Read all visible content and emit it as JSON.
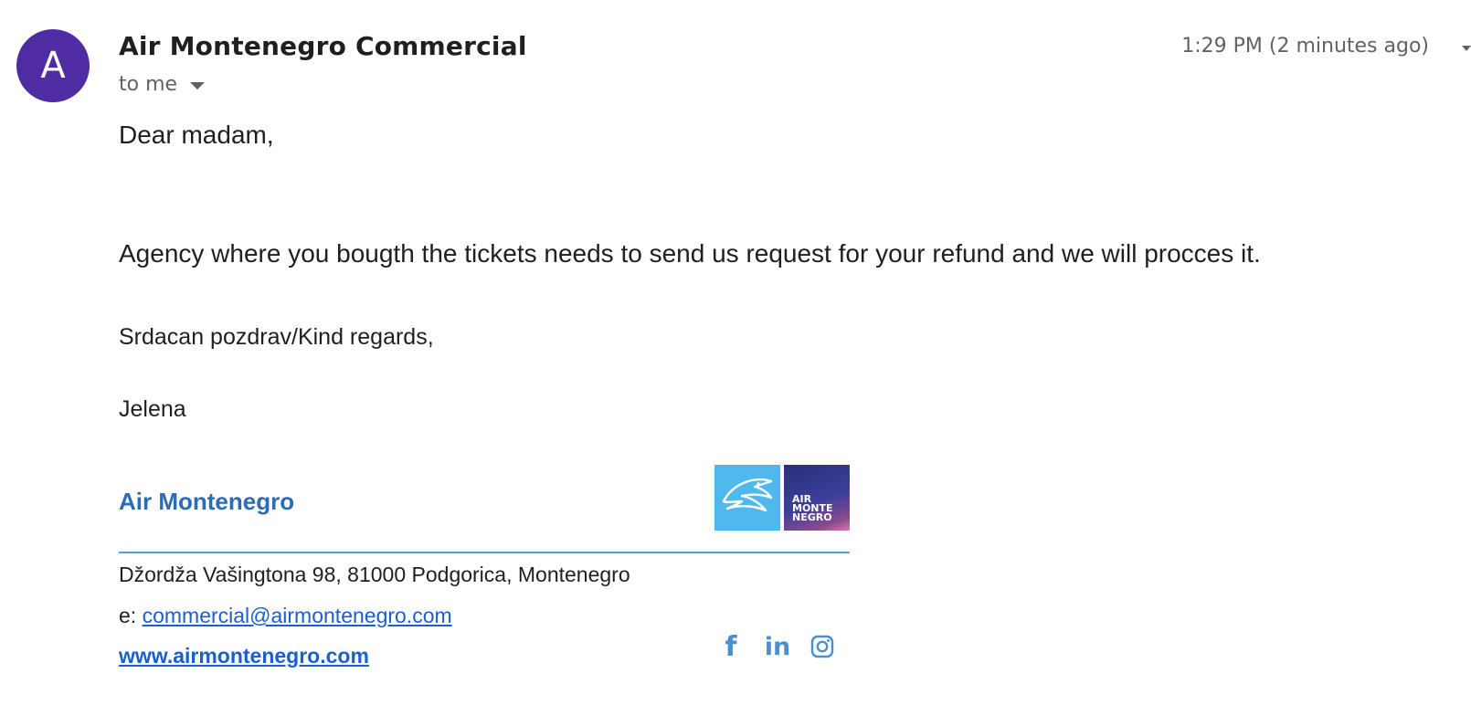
{
  "header": {
    "avatar_letter": "A",
    "sender_name": "Air Montenegro Commercial",
    "recipient": "to me",
    "timestamp": "1:29 PM (2 minutes ago)"
  },
  "body": {
    "greeting": "Dear madam,",
    "text": "Agency where you bougth the tickets needs to send us request for your refund and we will procces it.",
    "regards": "Srdacan pozdrav/Kind regards,",
    "name": "Jelena"
  },
  "signature": {
    "company": "Air Montenegro",
    "logo_wordmark": [
      "AIR",
      "MONTE",
      "NEGRO"
    ],
    "address": "Džordža Vašingtona 98, 81000 Podgorica, Montenegro",
    "email_label": "e:",
    "email": "commercial@airmontenegro.com",
    "website": "www.airmontenegro.com",
    "social": [
      "facebook-icon",
      "linkedin-icon",
      "instagram-icon"
    ],
    "colors": {
      "brand_blue": "#2b6cb8",
      "logo_light": "#4fb9ee",
      "link": "#1a5fcf"
    }
  },
  "colors": {
    "avatar": "#4f2ca3"
  }
}
